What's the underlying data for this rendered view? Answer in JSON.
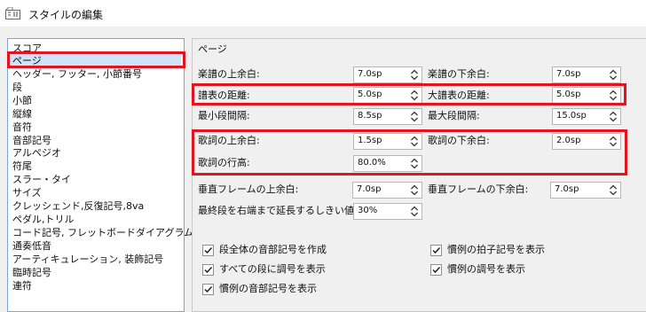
{
  "window": {
    "title": "スタイルの編集"
  },
  "sidebar": {
    "items": [
      {
        "label": "スコア"
      },
      {
        "label": "ページ",
        "selected": true
      },
      {
        "label": "ヘッダー, フッター, 小節番号"
      },
      {
        "label": "段"
      },
      {
        "label": "小節"
      },
      {
        "label": "縦線"
      },
      {
        "label": "音符"
      },
      {
        "label": "音部記号"
      },
      {
        "label": "アルペジオ"
      },
      {
        "label": "符尾"
      },
      {
        "label": "スラー・タイ"
      },
      {
        "label": "サイズ"
      },
      {
        "label": "クレッシェンド,反復記号,8va"
      },
      {
        "label": "ペダル,トリル"
      },
      {
        "label": "コード記号, フレットボードダイアグラム"
      },
      {
        "label": "通奏低音"
      },
      {
        "label": "アーティキュレーション, 装飾記号"
      },
      {
        "label": "臨時記号"
      },
      {
        "label": "連符"
      }
    ]
  },
  "page": {
    "section_title": "ページ",
    "staff_top_margin": {
      "label": "楽譜の上余白:",
      "value": "7.0sp"
    },
    "staff_bottom_margin": {
      "label": "楽譜の下余白:",
      "value": "7.0sp"
    },
    "staff_distance": {
      "label": "譜表の距離:",
      "value": "5.0sp"
    },
    "grand_staff_distance": {
      "label": "大譜表の距離:",
      "value": "5.0sp"
    },
    "min_system_distance": {
      "label": "最小段間隔:",
      "value": "8.5sp"
    },
    "max_system_distance": {
      "label": "最大段間隔:",
      "value": "15.0sp"
    },
    "lyrics_top_margin": {
      "label": "歌詞の上余白:",
      "value": "1.5sp"
    },
    "lyrics_bottom_margin": {
      "label": "歌詞の下余白:",
      "value": "2.0sp"
    },
    "lyrics_line_height": {
      "label": "歌詞の行高:",
      "value": "80.0%"
    },
    "vframe_top_margin": {
      "label": "垂直フレームの上余白:",
      "value": "7.0sp"
    },
    "vframe_bottom_margin": {
      "label": "垂直フレームの下余白:",
      "value": "7.0sp"
    },
    "last_system_fill": {
      "label": "最終段を右端まで延長するしきい値:",
      "value": "30%"
    },
    "checkboxes": {
      "clef_all_systems": {
        "label": "段全体の音部記号を作成",
        "checked": true
      },
      "courtesy_time_sig": {
        "label": "慣例の拍子記号を表示",
        "checked": true
      },
      "key_all_systems": {
        "label": "すべての段に調号を表示",
        "checked": true
      },
      "courtesy_key_sig": {
        "label": "慣例の調号を表示",
        "checked": true
      },
      "courtesy_clef": {
        "label": "慣例の音部記号を表示",
        "checked": true
      }
    }
  },
  "colors": {
    "highlight": "#e3141e",
    "selection": "#cde4fb",
    "list_border": "#7aa7d9"
  },
  "icons": {
    "app": "app-icon",
    "spin": "spin-arrows-icon",
    "check": "check-icon"
  }
}
